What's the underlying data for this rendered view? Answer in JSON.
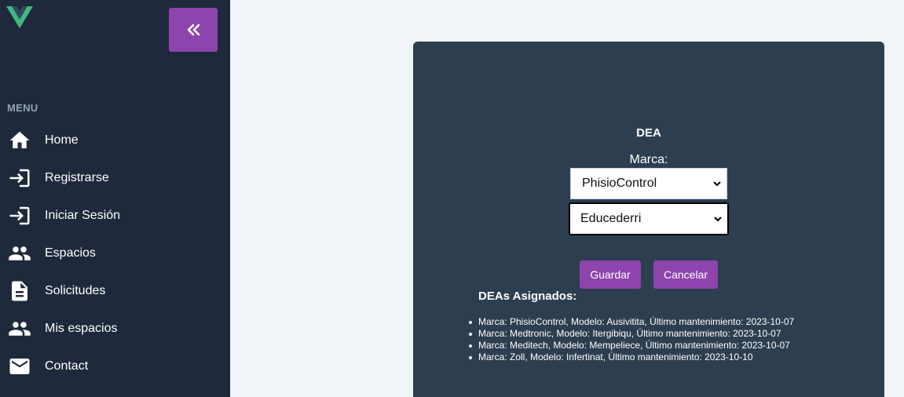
{
  "sidebar": {
    "menu_heading": "MENU",
    "items": [
      {
        "label": "Home",
        "icon": "home-icon"
      },
      {
        "label": "Registrarse",
        "icon": "login-icon"
      },
      {
        "label": "Iniciar Sesión",
        "icon": "login-icon"
      },
      {
        "label": "Espacios",
        "icon": "people-icon"
      },
      {
        "label": "Solicitudes",
        "icon": "document-icon"
      },
      {
        "label": "Mis espacios",
        "icon": "people-icon"
      },
      {
        "label": "Contact",
        "icon": "mail-icon"
      }
    ]
  },
  "form": {
    "title": "DEA",
    "marca_label": "Marca:",
    "marca_value": "PhisioControl",
    "modelo_value": "Educederri",
    "save_label": "Guardar",
    "cancel_label": "Cancelar"
  },
  "assigned": {
    "title": "DEAs Asignados:",
    "items": [
      "Marca: PhisioControl, Modelo: Ausivitita, Último mantenimiento: 2023-10-07",
      "Marca: Medtronic, Modelo: Itergibiqu, Último mantenimiento: 2023-10-07",
      "Marca: Meditech, Modelo: Mempeliece, Último mantenimiento: 2023-10-07",
      "Marca: Zoll, Modelo: Infertinat, Último mantenimiento: 2023-10-10"
    ]
  },
  "colors": {
    "sidebar_bg": "#1e293b",
    "accent": "#8e44ad",
    "card_bg": "#2d3e50",
    "page_bg": "#f1f5f9"
  }
}
